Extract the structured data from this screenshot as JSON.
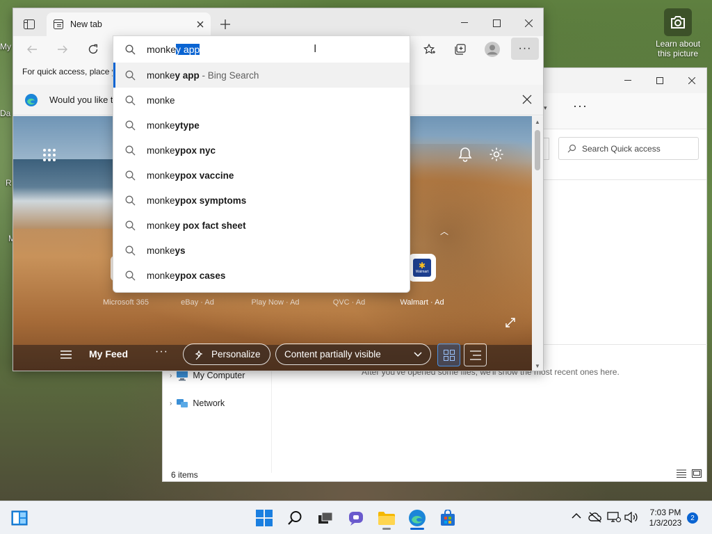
{
  "desktop": {
    "spotlight_label": "Learn about this picture",
    "left_fragments": [
      "My",
      "Da",
      "R",
      "M"
    ]
  },
  "explorer": {
    "search_placeholder": "Search Quick access",
    "nav": [
      {
        "label": "My Computer"
      },
      {
        "label": "Network"
      }
    ],
    "empty_text": "After you've opened some files, we'll show the most recent ones here.",
    "status": "6 items"
  },
  "browser": {
    "tab_title": "New tab",
    "favorites_prompt": "For quick access, place y",
    "infobar_text": "Would you like t",
    "quick_links": [
      {
        "label": "Microsoft 365"
      },
      {
        "label": "eBay · Ad"
      },
      {
        "label": "Play Now · Ad"
      },
      {
        "label": "QVC · Ad"
      },
      {
        "label": "Walmart · Ad"
      }
    ],
    "walmart_tile": "Walmart",
    "feed": {
      "title": "My Feed",
      "personalize": "Personalize",
      "content_visibility": "Content partially visible"
    }
  },
  "omnibox": {
    "typed": "monke",
    "completion": "y app",
    "suggestions": [
      {
        "base": "monke",
        "bold": "y app",
        "source": " - Bing Search",
        "active": true
      },
      {
        "base": "monke",
        "bold": "",
        "source": ""
      },
      {
        "base": "monke",
        "bold": "ytype",
        "source": ""
      },
      {
        "base": "monke",
        "bold": "ypox nyc",
        "source": ""
      },
      {
        "base": "monke",
        "bold": "ypox vaccine",
        "source": ""
      },
      {
        "base": "monke",
        "bold": "ypox symptoms",
        "source": ""
      },
      {
        "base": "monke",
        "bold": "y pox fact sheet",
        "source": ""
      },
      {
        "base": "monke",
        "bold": "ys",
        "source": ""
      },
      {
        "base": "monke",
        "bold": "ypox cases",
        "source": ""
      }
    ]
  },
  "taskbar": {
    "time": "7:03 PM",
    "date": "1/3/2023",
    "notifications": "2"
  },
  "colors": {
    "accent": "#0a64d2",
    "taskbar": "#eef1f5"
  }
}
